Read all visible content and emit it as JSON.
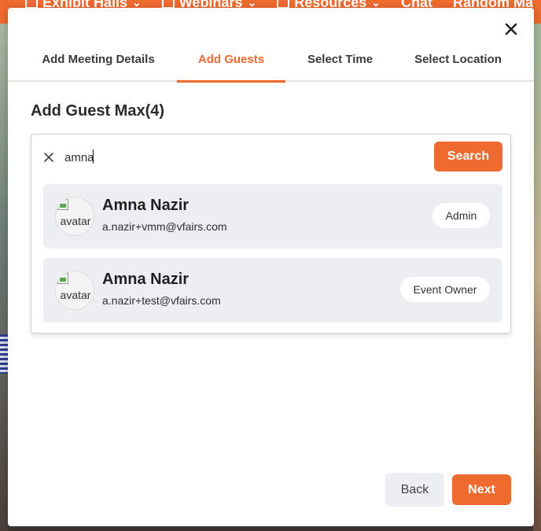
{
  "background_nav": {
    "items": [
      {
        "label": "Exhibit Halls",
        "icon": "calendar-icon",
        "chevron": "⌄"
      },
      {
        "label": "Webinars",
        "icon": "video-icon",
        "chevron": "⌄"
      },
      {
        "label": "Resources",
        "icon": "list-icon",
        "chevron": "⌄"
      },
      {
        "label": "Chat",
        "icon": "",
        "chevron": ""
      },
      {
        "label": "Random Ma",
        "icon": "",
        "chevron": ""
      }
    ]
  },
  "modal": {
    "close_icon": "close-icon",
    "tabs": [
      {
        "label": "Add Meeting Details",
        "active": false
      },
      {
        "label": "Add Guests",
        "active": true
      },
      {
        "label": "Select Time",
        "active": false
      },
      {
        "label": "Select Location",
        "active": false
      }
    ],
    "section_title": "Add Guest Max(4)",
    "search": {
      "value": "amna",
      "placeholder": "",
      "button_label": "Search"
    },
    "results": [
      {
        "name": "Amna Nazir",
        "email": "a.nazir+vmm@vfairs.com",
        "role": "Admin",
        "avatar_alt": "avatar"
      },
      {
        "name": "Amna Nazir",
        "email": "a.nazir+test@vfairs.com",
        "role": "Event Owner",
        "avatar_alt": "avatar"
      }
    ],
    "footer": {
      "back_label": "Back",
      "next_label": "Next"
    }
  },
  "colors": {
    "accent": "#ee6a2f",
    "result_bg": "#edeef1",
    "text_dark": "#1f1f1f"
  }
}
